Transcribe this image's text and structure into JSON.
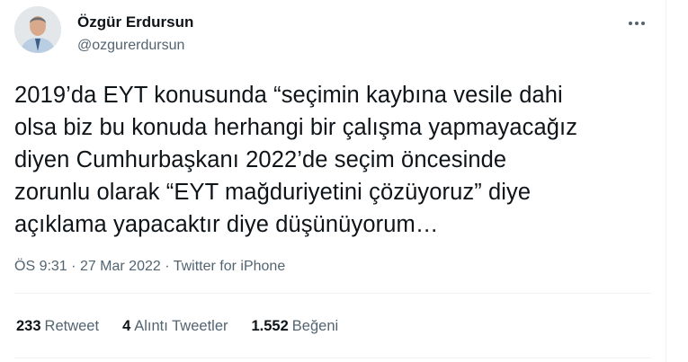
{
  "author": {
    "name": "Özgür Erdursun",
    "handle": "@ozgurerdursun"
  },
  "tweet": {
    "text": "2019’da EYT konusunda “seçimin kaybına vesile dahi\nolsa biz bu konuda herhangi bir çalışma yapmayacağız\ndiyen Cumhurbaşkanı 2022’de seçim öncesinde\nzorunlu olarak “EYT mağduriyetini çözüyoruz” diye\naçıklama yapacaktır diye düşünüyorum…",
    "time": "ÖS 9:31",
    "sep1": "·",
    "date": "27 Mar 2022",
    "sep2": "·",
    "source": "Twitter for iPhone"
  },
  "stats": {
    "retweets_count": "233",
    "retweets_label": "Retweet",
    "quotes_count": "4",
    "quotes_label": "Alıntı Tweetler",
    "likes_count": "1.552",
    "likes_label": "Beğeni"
  },
  "icons": {
    "more": "more-horizontal-icon"
  }
}
